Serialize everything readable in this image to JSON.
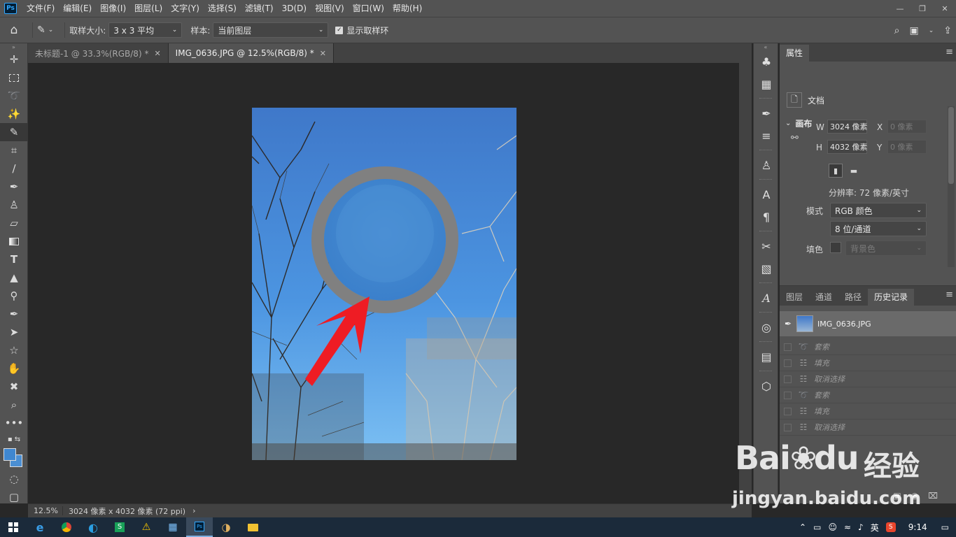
{
  "app": {
    "logo_text": "Ps",
    "menu": [
      "文件(F)",
      "编辑(E)",
      "图像(I)",
      "图层(L)",
      "文字(Y)",
      "选择(S)",
      "滤镜(T)",
      "3D(D)",
      "视图(V)",
      "窗口(W)",
      "帮助(H)"
    ]
  },
  "options": {
    "sample_size_label": "取样大小:",
    "sample_size_value": "3 x 3 平均",
    "sample_label": "样本:",
    "sample_value": "当前图层",
    "show_ring_label": "显示取样环",
    "show_ring_checked": true
  },
  "tabs": [
    {
      "label": "未标题-1 @ 33.3%(RGB/8) *",
      "active": false
    },
    {
      "label": "IMG_0636.JPG @ 12.5%(RGB/8) *",
      "active": true
    }
  ],
  "status": {
    "zoom": "12.5%",
    "doc_info": "3024 像素 x 4032 像素 (72 ppi)"
  },
  "properties": {
    "tab_label": "属性",
    "doc_label": "文档",
    "canvas_section": "画布",
    "w_label": "W",
    "w_value": "3024 像素",
    "h_label": "H",
    "h_value": "4032 像素",
    "x_label": "X",
    "x_value": "0 像素",
    "y_label": "Y",
    "y_value": "0 像素",
    "resolution": "分辨率: 72 像素/英寸",
    "mode_label": "模式",
    "mode_value": "RGB 颜色",
    "bit_value": "8 位/通道",
    "fill_label": "填色",
    "fill_value": "背景色"
  },
  "history": {
    "tabs": [
      "图层",
      "通道",
      "路径",
      "历史记录"
    ],
    "active_tab": "历史记录",
    "snapshot": "IMG_0636.JPG",
    "items": [
      {
        "label": "套索",
        "icon": "lasso-icon"
      },
      {
        "label": "填充",
        "icon": "fill-icon"
      },
      {
        "label": "取消选择",
        "icon": "deselect-icon"
      },
      {
        "label": "套索",
        "icon": "lasso-icon"
      },
      {
        "label": "填充",
        "icon": "fill-icon"
      },
      {
        "label": "取消选择",
        "icon": "deselect-icon"
      }
    ]
  },
  "taskbar": {
    "ime": "英",
    "time": "9:14"
  },
  "watermark": {
    "brand": "Bai",
    "brand2": "du",
    "cn": "经验",
    "url": "jingyan.baidu.com"
  },
  "colors": {
    "accent": "#31a8ff",
    "arrow": "#ee1c24",
    "ring": "#808080"
  }
}
